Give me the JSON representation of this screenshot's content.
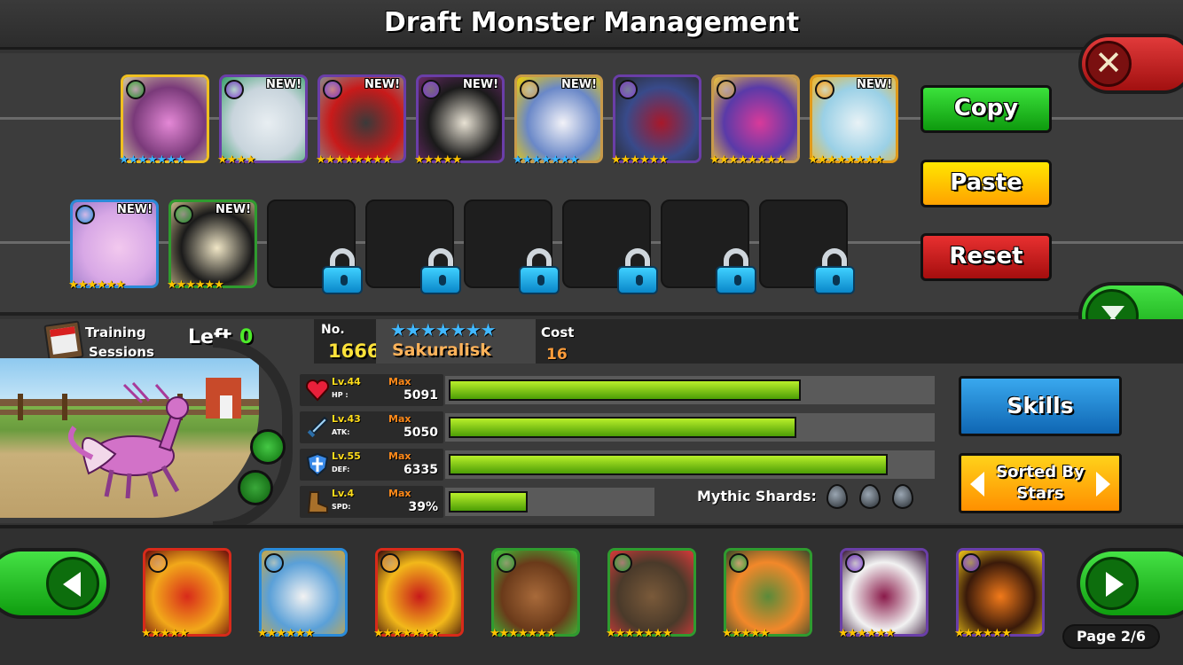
{
  "header": {
    "title": "Draft Monster Management"
  },
  "team": {
    "row1": [
      {
        "element": "nature",
        "elem_color": "#2f9b2f",
        "is_new": false,
        "new_label": "",
        "stars": "★★★★★★★",
        "star_color": "blue",
        "colors": [
          "#e488d6",
          "#7a3a7a",
          "#d1c9a0"
        ],
        "border": "#f0c020"
      },
      {
        "element": "dark",
        "elem_color": "#7a3ec9",
        "is_new": true,
        "new_label": "NEW!",
        "stars": "★★★★",
        "star_color": "gold",
        "colors": [
          "#e8eef2",
          "#c8d4dc",
          "#37a06a"
        ],
        "border": "#6a3ea8"
      },
      {
        "element": "dark",
        "elem_color": "#7a3ec9",
        "is_new": true,
        "new_label": "NEW!",
        "stars": "★★★★★★★★",
        "star_color": "gold",
        "colors": [
          "#3a3a3a",
          "#c81a1a",
          "#8a8a8a"
        ],
        "border": "#6a3ea8"
      },
      {
        "element": "dark",
        "elem_color": "#7a3ec9",
        "is_new": true,
        "new_label": "NEW!",
        "stars": "★★★★★",
        "star_color": "gold",
        "colors": [
          "#e8e2d4",
          "#1a1a1a",
          "#6a2a6a"
        ],
        "border": "#6a3ea8"
      },
      {
        "element": "legend",
        "elem_color": "#c89a4a",
        "is_new": true,
        "new_label": "NEW!",
        "stars": "★★★★★★★",
        "star_color": "blue",
        "colors": [
          "#f2f2f8",
          "#6a88c8",
          "#f2d000"
        ],
        "border": "#c89a4a"
      },
      {
        "element": "dark",
        "elem_color": "#7a3ec9",
        "is_new": false,
        "new_label": "",
        "stars": "★★★★★★",
        "star_color": "gold",
        "colors": [
          "#a8182a",
          "#384a8a",
          "#2a2a2a"
        ],
        "border": "#6a3ea8"
      },
      {
        "element": "legend",
        "elem_color": "#c89a4a",
        "is_new": false,
        "new_label": "",
        "stars": "★★★★★★★★",
        "star_color": "gold",
        "colors": [
          "#d83a9a",
          "#5a3aa8",
          "#f2c83a"
        ],
        "border": "#c89a4a"
      },
      {
        "element": "fire",
        "elem_color": "#f09a1a",
        "is_new": true,
        "new_label": "NEW!",
        "stars": "★★★★★★★★",
        "star_color": "gold",
        "colors": [
          "#e8f2f6",
          "#9ad0e6",
          "#f2b82a"
        ],
        "border": "#e09a1a"
      }
    ],
    "row2": [
      {
        "element": "water",
        "elem_color": "#2a8ad8",
        "is_new": true,
        "new_label": "NEW!",
        "stars": "★★★★★★",
        "star_color": "gold",
        "colors": [
          "#f2c8ee",
          "#d8a8e6",
          "#9a78c8"
        ],
        "border": "#2a8ad8"
      },
      {
        "element": "nature",
        "elem_color": "#2f9b2f",
        "is_new": true,
        "new_label": "NEW!",
        "stars": "★★★★★★",
        "star_color": "gold",
        "colors": [
          "#f0e6c6",
          "#1a1a1a",
          "#c8b88a"
        ],
        "border": "#2f9b2f"
      }
    ]
  },
  "buttons": {
    "copy": "Copy",
    "paste": "Paste",
    "reset": "Reset"
  },
  "training": {
    "label_line1": "Training",
    "label_line2": "Sessions",
    "left_label": "Left",
    "left_value": "0"
  },
  "monster": {
    "no_label": "No.",
    "number": "1666",
    "stars": "★★★★★★★",
    "name": "Sakuralisk",
    "cost_label": "Cost",
    "cost": "16"
  },
  "stats": [
    {
      "key": "hp",
      "icon": "heart-icon",
      "level": "Lv.44",
      "max_label": "Max",
      "name": "HP :",
      "value": "5091",
      "fill": 0.73,
      "track": "long"
    },
    {
      "key": "atk",
      "icon": "sword-icon",
      "level": "Lv.43",
      "max_label": "Max",
      "name": "ATK:",
      "value": "5050",
      "fill": 0.72,
      "track": "long"
    },
    {
      "key": "def",
      "icon": "shield-icon",
      "level": "Lv.55",
      "max_label": "Max",
      "name": "DEF:",
      "value": "6335",
      "fill": 0.91,
      "track": "long"
    },
    {
      "key": "spd",
      "icon": "boot-icon",
      "level": "Lv.4",
      "max_label": "Max",
      "name": "SPD:",
      "value": "39%",
      "fill": 0.39,
      "track": "short"
    }
  ],
  "mythic": {
    "label": "Mythic Shards:",
    "count": 3
  },
  "side_buttons": {
    "skills": "Skills",
    "sort_line1": "Sorted By",
    "sort_line2": "Stars"
  },
  "collection": [
    {
      "element": "fire",
      "elem_color": "#f09a1a",
      "stars": "★★★★★",
      "colors": [
        "#d82a1a",
        "#f2a81a",
        "#6a0a0a"
      ],
      "border": "#d82a1a"
    },
    {
      "element": "water",
      "elem_color": "#2a8ad8",
      "stars": "★★★★★★",
      "colors": [
        "#f2f2f2",
        "#5aa0d8",
        "#c8a84a"
      ],
      "border": "#2a8ad8"
    },
    {
      "element": "fire",
      "elem_color": "#f09a1a",
      "stars": "★★★★★★★",
      "colors": [
        "#c81a1a",
        "#f2b81a",
        "#3a0a0a"
      ],
      "border": "#d82a1a"
    },
    {
      "element": "nature",
      "elem_color": "#2f9b2f",
      "stars": "★★★★★★★",
      "colors": [
        "#a86a3a",
        "#6a3a1a",
        "#3ac83a"
      ],
      "border": "#2f9b2f"
    },
    {
      "element": "nature",
      "elem_color": "#2f9b2f",
      "stars": "★★★★★★★",
      "colors": [
        "#7a5a3a",
        "#4a3a2a",
        "#d83a3a"
      ],
      "border": "#2f9b2f"
    },
    {
      "element": "nature",
      "elem_color": "#2f9b2f",
      "stars": "★★★★★",
      "colors": [
        "#5a8a3a",
        "#f2882a",
        "#3a4a2a"
      ],
      "border": "#2f9b2f"
    },
    {
      "element": "dark",
      "elem_color": "#7a3ec9",
      "stars": "★★★★★★",
      "colors": [
        "#8a1a4a",
        "#f2f2f2",
        "#3a1a3a"
      ],
      "border": "#6a3ea8"
    },
    {
      "element": "dark",
      "elem_color": "#7a3ec9",
      "stars": "★★★★★★",
      "colors": [
        "#f27a1a",
        "#3a1a0a",
        "#f2c81a"
      ],
      "border": "#6a3ea8"
    }
  ],
  "pagination": {
    "label": "Page 2/6"
  }
}
